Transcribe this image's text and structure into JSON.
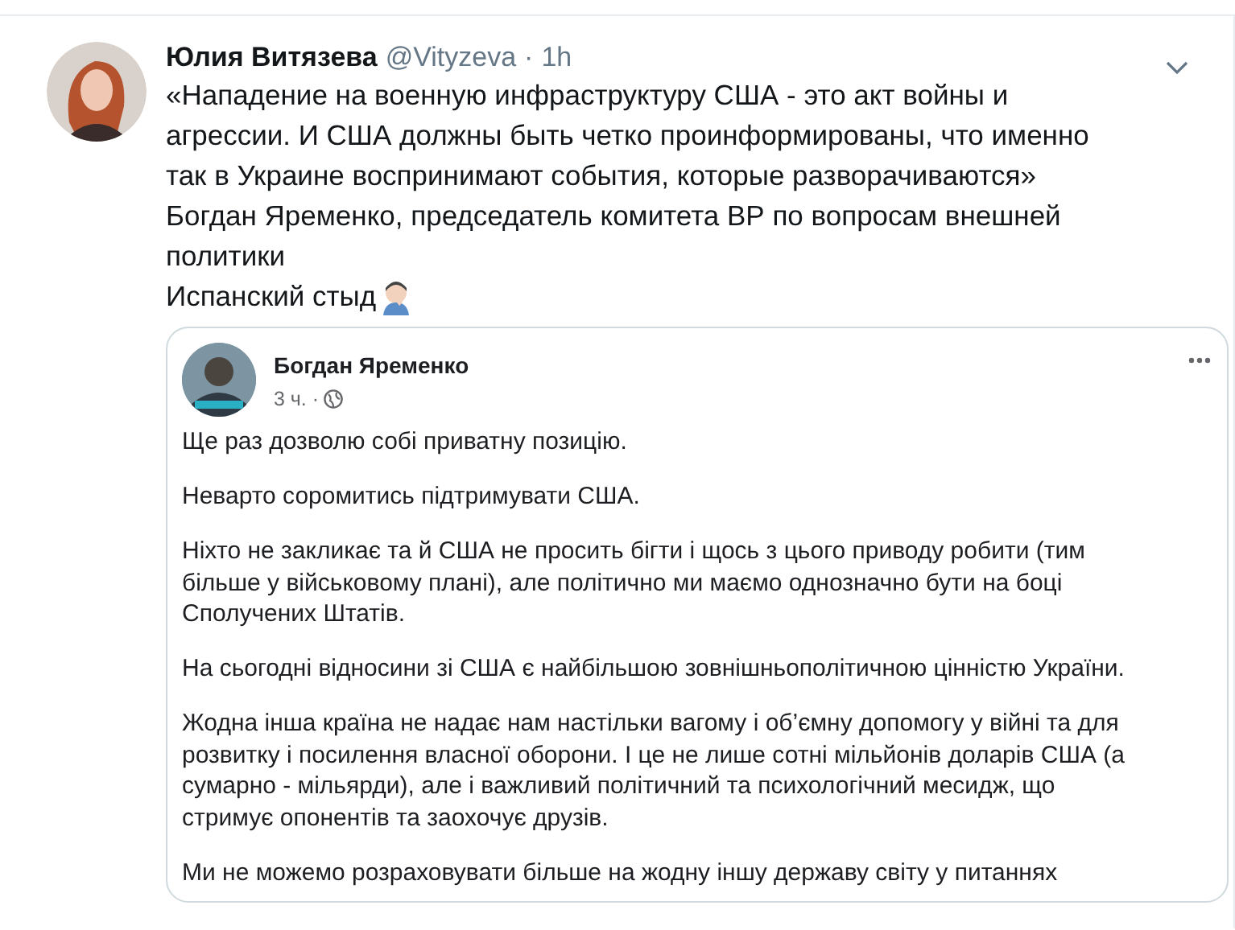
{
  "tweet": {
    "author": "Юлия Витязева",
    "handle": "@Vityzeva",
    "separator": "·",
    "time": "1h",
    "paragraphs": [
      "«Нападение на военную инфраструктуру США - это акт войны и агрессии. И США должны быть четко проинформированы, что именно так в Украине воспринимают события, которые разворачиваются»",
      "Богдан Яременко, председатель комитета ВР по вопросам внешней политики",
      "Испанский стыд"
    ]
  },
  "embedded_post": {
    "author": "Богдан Яременко",
    "time": "3 ч. ·",
    "paragraphs": [
      "Ще раз дозволю собі приватну позицію.",
      "Неварто соромитись підтримувати США.",
      "Ніхто не закликає та й США не просить бігти і щось з цього приводу робити (тим більше у військовому плані), але політично ми маємо однозначно бути на боці Сполучених Штатів.",
      "На сьогодні відносини зі США є найбільшою зовнішньополітичною цінністю України.",
      "Жодна інша країна не надає нам настільки вагому і об’ємну допомогу у війні та для розвитку і посилення власної оборони. І це не лише сотні мільйонів доларів США (а сумарно - мільярди), але і важливий політичний та психологічний месидж, що стримує опонентів та заохочує друзів.",
      "Ми не можемо розраховувати більше на жодну іншу державу світу у питаннях"
    ]
  }
}
